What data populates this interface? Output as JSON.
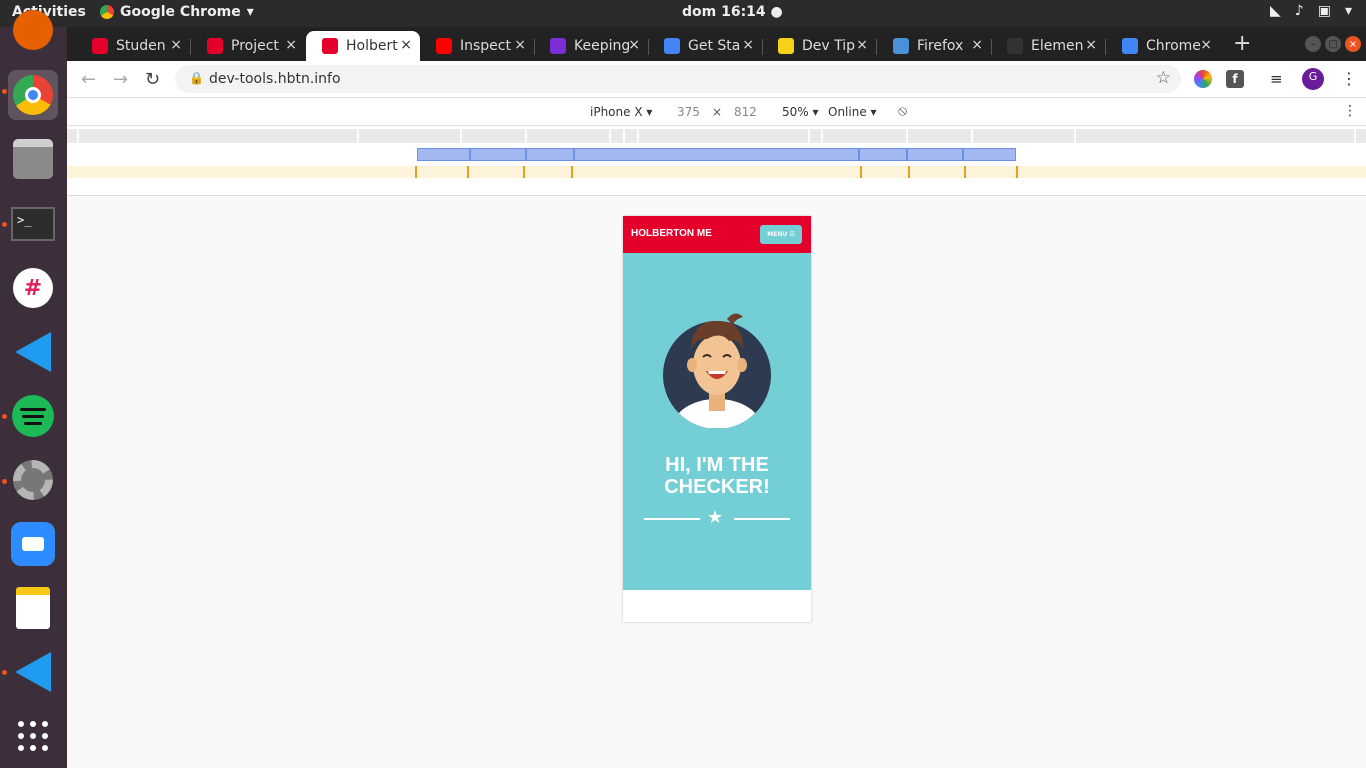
{
  "topbar": {
    "activities": "Activities",
    "app_name": "Google Chrome",
    "clock": "dom 16:14"
  },
  "tabs": [
    {
      "title": "Studen",
      "icon": "holberton-icon",
      "color": "#e4002b"
    },
    {
      "title": "Project",
      "icon": "holberton-icon",
      "color": "#e4002b"
    },
    {
      "title": "Holbert",
      "icon": "holberton-icon",
      "color": "#e4002b",
      "active": true
    },
    {
      "title": "Inspect",
      "icon": "youtube-icon",
      "color": "#ff0000"
    },
    {
      "title": "Keeping",
      "icon": "keeping-icon",
      "color": "#7b2ed6"
    },
    {
      "title": "Get Sta",
      "icon": "chrome-devtools-icon",
      "color": "#4285f4"
    },
    {
      "title": "Dev Tip",
      "icon": "u-icon",
      "color": "#f7d117"
    },
    {
      "title": "Firefox",
      "icon": "firefox-icon",
      "color": "#4a90d9"
    },
    {
      "title": "Elemen",
      "icon": "dark-icon",
      "color": "#333333"
    },
    {
      "title": "Chrome",
      "icon": "chrome-devtools-icon",
      "color": "#4285f4"
    }
  ],
  "omnibox": {
    "url": "dev-tools.hbtn.info"
  },
  "avatar_letter": "G",
  "device_toolbar": {
    "device": "iPhone X",
    "width": "375",
    "times": "×",
    "height": "812",
    "zoom": "50%",
    "throttle": "Online"
  },
  "site": {
    "brand": "HOLBERTON ME",
    "menu_label": "MENU ☰",
    "hero_title": "HI, I'M THE\nCHECKER!"
  },
  "colors": {
    "accent_red": "#e4002b",
    "hero_teal": "#73cfd5"
  }
}
